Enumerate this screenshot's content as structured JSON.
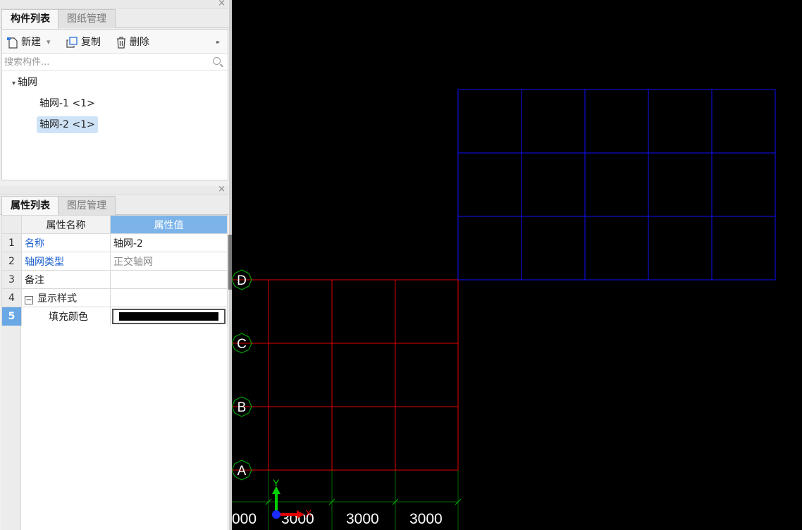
{
  "component_panel": {
    "tabs": [
      "构件列表",
      "图纸管理"
    ],
    "close_glyph": "×",
    "toolbar": {
      "new_label": "新建",
      "new_dropdown_glyph": "▾",
      "copy_label": "复制",
      "delete_label": "删除",
      "more_glyph": "▸▸"
    },
    "search": {
      "placeholder": "搜索构件..."
    },
    "tree": {
      "root_label": "轴网",
      "root_arrow": "▾",
      "items": [
        "轴网-1 <1>",
        "轴网-2 <1>"
      ],
      "selected_index": 1
    }
  },
  "property_panel": {
    "tabs": [
      "属性列表",
      "图层管理"
    ],
    "close_glyph": "×",
    "headers": {
      "name": "属性名称",
      "value": "属性值"
    },
    "rows": [
      {
        "num": "1",
        "name": "名称",
        "value": "轴网-2"
      },
      {
        "num": "2",
        "name": "轴网类型",
        "value": "正交轴网"
      },
      {
        "num": "3",
        "name": "备注",
        "value": ""
      },
      {
        "num": "4",
        "name": "显示样式",
        "value": "",
        "toggle": "−"
      },
      {
        "num": "5",
        "name": "填充颜色",
        "value_color": "#000000"
      }
    ],
    "selected_row": "5"
  },
  "canvas": {
    "background": "#000000",
    "grid_colors": {
      "blue": "#1010ff",
      "red": "#e00000",
      "green": "#006a00",
      "axis_green": "#00b400"
    },
    "axis_labels": [
      "D",
      "C",
      "B",
      "A"
    ],
    "dimension_labels": [
      "000",
      "3000",
      "3000",
      "3000"
    ],
    "ucs": {
      "y_label": "Y",
      "x_label": "X"
    }
  }
}
